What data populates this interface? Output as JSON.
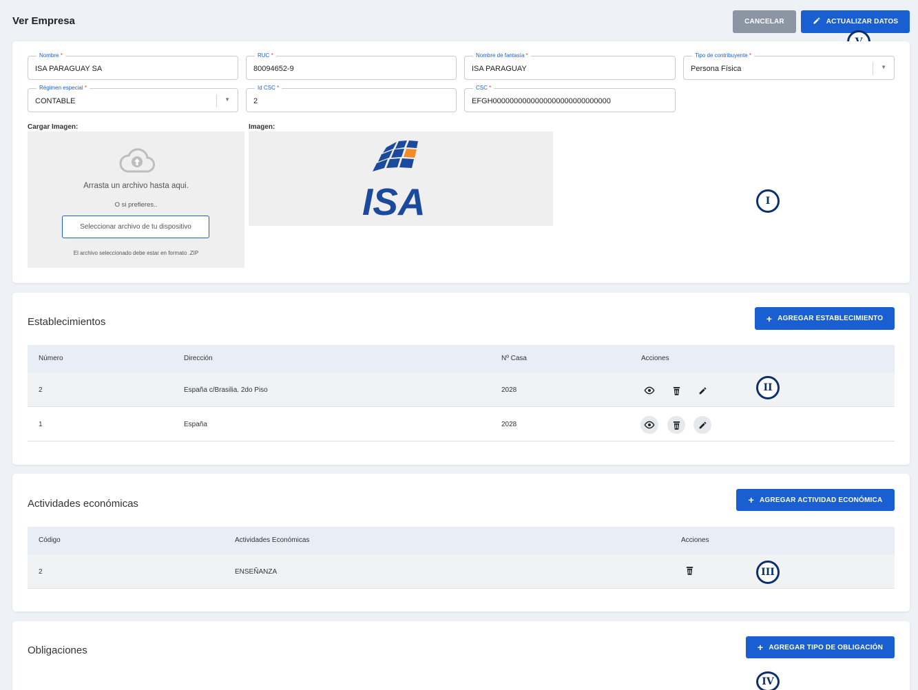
{
  "header": {
    "title": "Ver Empresa",
    "cancel_label": "CANCELAR",
    "update_label": "ACTUALIZAR DATOS"
  },
  "form": {
    "nombre": {
      "label": "Nombre",
      "value": "ISA PARAGUAY SA"
    },
    "ruc": {
      "label": "RUC",
      "value": "80094652-9"
    },
    "fantasia": {
      "label": "Nombre de fantasía",
      "value": "ISA PARAGUAY"
    },
    "contribuyente": {
      "label": "Tipo de contribuyente",
      "value": "Persona Física"
    },
    "regimen": {
      "label": "Régimen especial",
      "value": "CONTABLE"
    },
    "idcsc": {
      "label": "Id CSC",
      "value": "2"
    },
    "csc": {
      "label": "CSC",
      "value": "EFGH0000000000000000000000000000"
    },
    "required_mark": "*"
  },
  "upload": {
    "label": "Cargar Imagen:",
    "drag_text": "Arrasta un archivo hasta aqui.",
    "or_text": "O si prefieres..",
    "select_label": "Seleccionar archivo de tu dispositivo",
    "hint": "El archivo seleccionado debe estar en formato .ZIP",
    "icon": "cloud-upload-icon"
  },
  "image": {
    "label": "Imagen:",
    "logo_text": "ISA"
  },
  "establecimientos": {
    "title": "Establecimientos",
    "add_label": "AGREGAR ESTABLECIMIENTO",
    "columns": [
      "Número",
      "Dirección",
      "Nº Casa",
      "Acciones"
    ],
    "rows": [
      {
        "numero": "2",
        "direccion": "España c/Brasilia. 2do Piso",
        "casa": "2028"
      },
      {
        "numero": "1",
        "direccion": "España",
        "casa": "2028"
      }
    ]
  },
  "actividades": {
    "title": "Actividades económicas",
    "add_label": "AGREGAR ACTIVIDAD ECONÓMICA",
    "columns": [
      "Código",
      "Actividades Económicas",
      "Acciones"
    ],
    "rows": [
      {
        "codigo": "2",
        "actividad": "ENSEÑANZA"
      }
    ]
  },
  "obligaciones": {
    "title": "Obligaciones",
    "add_label": "AGREGAR TIPO DE OBLIGACIÓN"
  },
  "markers": [
    "I",
    "II",
    "III",
    "IV",
    "V"
  ],
  "colors": {
    "primary": "#1a5fd1",
    "cancel": "#8b95a3",
    "marker": "#0b2e6e",
    "logo_blue": "#1b4a9c",
    "logo_orange": "#f28c28"
  }
}
